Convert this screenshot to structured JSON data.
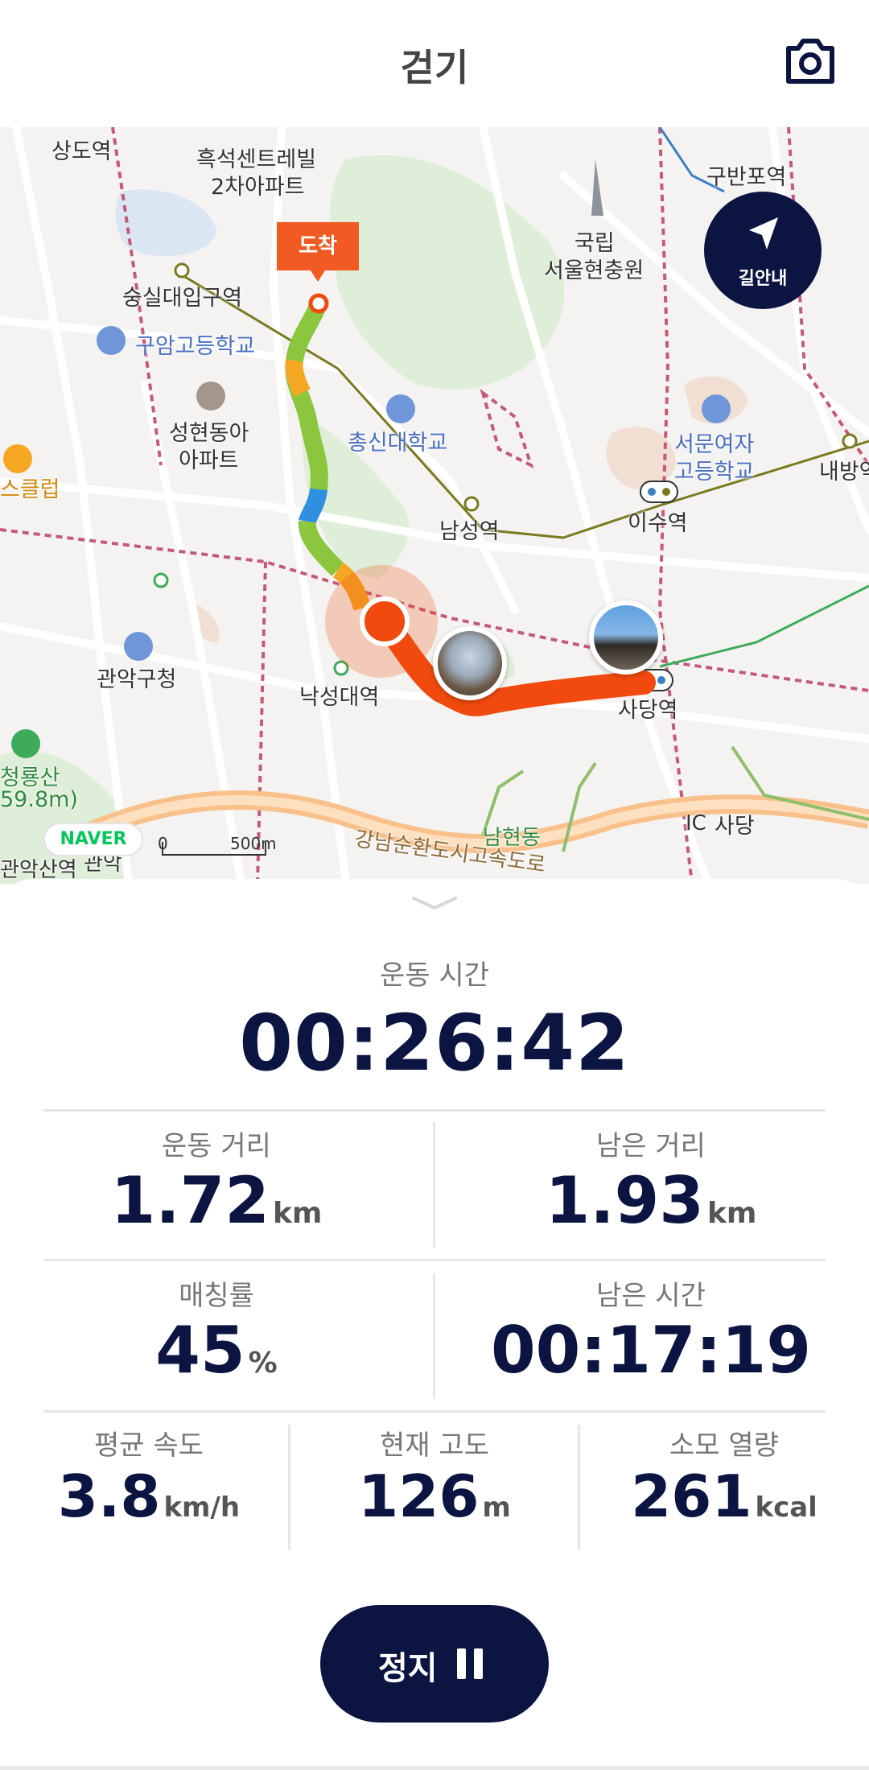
{
  "header": {
    "title": "걷기",
    "camera_icon": "camera-icon"
  },
  "map": {
    "arrival_label": "도착",
    "nav_button_label": "길안내",
    "watermark": "NAVER",
    "scale_zero": "0",
    "scale_distance": "500m",
    "places": {
      "sangdo": "상도역",
      "heukseok": "흑석센트레빌",
      "heukseok2": "2차아파트",
      "gubanpo": "구반포역",
      "guklip": "국립",
      "hyunchung": "서울현충원",
      "soongsil": "숭실대입구역",
      "guam": "구암고등학교",
      "seonghyeon": "성현동아",
      "apart": "아파트",
      "chongshin": "총신대학교",
      "seomun": "서문여자",
      "seomun2": "고등학교",
      "naebang": "내방역",
      "club": "스클럽",
      "namseong": "남성역",
      "isu": "이수역",
      "gwanakgu": "관악구청",
      "nakseongdae": "낙성대역",
      "sadang_station": "사당역",
      "cheongryong": "청룡산",
      "cheongryong_h": "59.8m)",
      "namhyeon": "남현동",
      "sadang": "사당",
      "gangnam_ring": "강남순환도시고속도로",
      "gwanaksan": "관악산역",
      "gwanak": "관악",
      "ic": "IC"
    },
    "colors": {
      "route_start": "#f04a0e",
      "route_mid": "#8cc63f",
      "route_alt": "#f5a623",
      "route_blue": "#2f8fe0"
    }
  },
  "stats": {
    "workout_time_label": "운동 시간",
    "workout_time": "00:26:42",
    "distance_label": "운동 거리",
    "distance_value": "1.72",
    "distance_unit": "km",
    "remaining_distance_label": "남은 거리",
    "remaining_distance_value": "1.93",
    "remaining_distance_unit": "km",
    "matching_label": "매칭률",
    "matching_value": "45",
    "matching_unit": "%",
    "remaining_time_label": "남은 시간",
    "remaining_time_value": "00:17:19",
    "avg_speed_label": "평균 속도",
    "avg_speed_value": "3.8",
    "avg_speed_unit": "km/h",
    "altitude_label": "현재 고도",
    "altitude_value": "126",
    "altitude_unit": "m",
    "calories_label": "소모 열량",
    "calories_value": "261",
    "calories_unit": "kcal"
  },
  "controls": {
    "stop_label": "정지",
    "pause_icon": "pause-icon",
    "brand_color": "#0c1442"
  }
}
